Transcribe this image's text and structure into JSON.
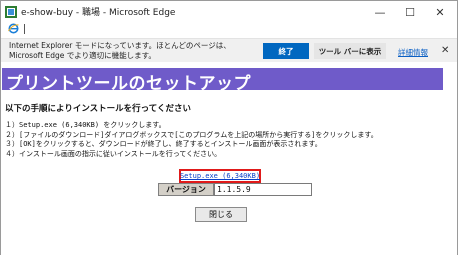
{
  "window": {
    "title": "e-show-buy - 職場 - Microsoft Edge",
    "min_glyph": "—",
    "max_glyph": "☐",
    "close_glyph": "✕"
  },
  "infobar": {
    "message": "Internet Explorer モードになっています。ほとんどのページは、Microsoft Edge でより適切に機能します。",
    "end_label": "終了",
    "toolbar_label": "ツール バーに表示",
    "details_label": "詳細情報",
    "close_glyph": "✕"
  },
  "page": {
    "banner": "プリントツールのセットアップ",
    "heading": "以下の手順によりインストールを行ってください",
    "steps": [
      "１）Setup.exe (6,340KB) をクリックします。",
      "２）[ファイルのダウンロード]ダイアログボックスで[このプログラムを上記の場所から実行する]をクリックします。",
      "３）[OK]をクリックすると、ダウンロードが終了し、終了するとインストール画面が表示されます。",
      "４）インストール画面の指示に従いインストールを行ってください。"
    ],
    "setup_link": "Setup.exe (6,340KB)",
    "version_label": "バージョン",
    "version_value": "1.1.5.9",
    "close_button": "閉じる"
  },
  "colors": {
    "banner_bg": "#6f5bc9",
    "highlight_box": "#e01a1a",
    "primary_button": "#0067c0"
  }
}
